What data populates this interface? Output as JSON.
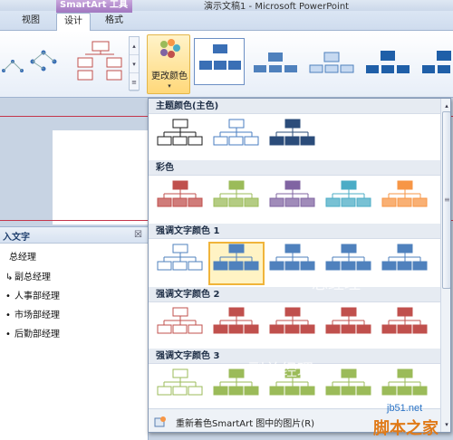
{
  "title_bar": {
    "context_tab": "SmartArt 工具",
    "window_title": "演示文稿1 - Microsoft PowerPoint"
  },
  "tabs": [
    {
      "label": "视图"
    },
    {
      "label": "设计"
    },
    {
      "label": "格式"
    }
  ],
  "ribbon": {
    "change_colors_label": "更改颜色",
    "dropdown_arrow": "▾",
    "scroll_glyphs": [
      "▴",
      "▾",
      "≡"
    ]
  },
  "gallery": {
    "sections": [
      {
        "header": "主题颜色(主色)",
        "colors": [
          "#1a1a1a",
          "#4a7ec2",
          "#2b4c7a"
        ],
        "styles": [
          "outline",
          "outline",
          "fill"
        ]
      },
      {
        "header": "彩色",
        "colors": [
          "#c0504d",
          "#9bbb59",
          "#8064a2",
          "#4bacc6",
          "#f79646"
        ],
        "styles": [
          "mixed",
          "mixed",
          "mixed",
          "mixed",
          "mixed"
        ]
      },
      {
        "header": "强调文字颜色 1",
        "colors": [
          "#4f81bd",
          "#4f81bd",
          "#4f81bd",
          "#4f81bd",
          "#4f81bd"
        ],
        "styles": [
          "outline",
          "fill",
          "fill",
          "fill",
          "fill"
        ]
      },
      {
        "header": "强调文字颜色 2",
        "colors": [
          "#c0504d",
          "#c0504d",
          "#c0504d",
          "#c0504d",
          "#c0504d"
        ],
        "styles": [
          "outline",
          "fill",
          "fill",
          "fill",
          "fill"
        ]
      },
      {
        "header": "强调文字颜色 3",
        "colors": [
          "#9bbb59",
          "#9bbb59",
          "#9bbb59",
          "#9bbb59",
          "#9bbb59"
        ],
        "styles": [
          "outline",
          "fill",
          "fill",
          "fill",
          "fill"
        ]
      }
    ],
    "recolor_label": "重新着色SmartArt 图中的图片(R)",
    "scroll_up": "▴",
    "scroll_down": "▾",
    "scroll_grip": "≡"
  },
  "text_pane": {
    "title": "入文字",
    "close_glyph": "☒",
    "items": [
      {
        "bullet": "",
        "text": "总经理"
      },
      {
        "bullet": "↳",
        "text": "副总经理"
      },
      {
        "bullet": "•",
        "text": "人事部经理"
      },
      {
        "bullet": "•",
        "text": "市场部经理"
      },
      {
        "bullet": "•",
        "text": "后勤部经理"
      }
    ]
  },
  "ghost_text": [
    "总经理",
    "副总经理"
  ],
  "watermark": {
    "site": "jb51.net",
    "name": "脚本之家"
  }
}
